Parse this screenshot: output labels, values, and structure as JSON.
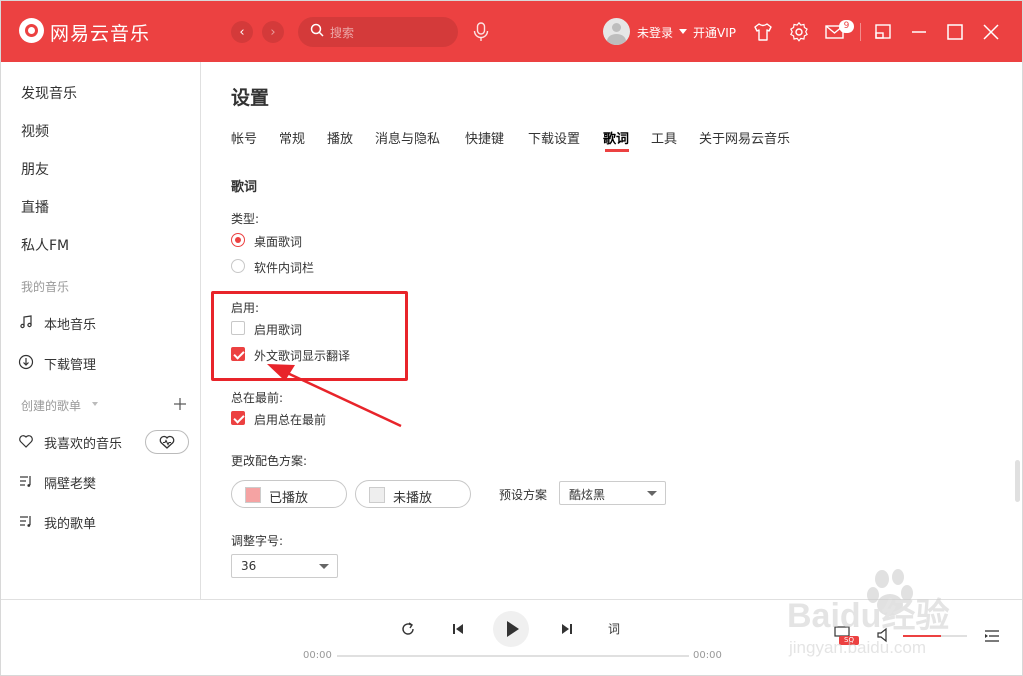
{
  "app": {
    "name": "网易云音乐"
  },
  "titlebar": {
    "search_placeholder": "搜索",
    "login_text": "未登录",
    "vip_text": "开通VIP",
    "mail_badge": "9"
  },
  "sidebar": {
    "main_items": [
      "发现音乐",
      "视频",
      "朋友",
      "直播",
      "私人FM"
    ],
    "my_music_title": "我的音乐",
    "my_music_items": [
      "本地音乐",
      "下载管理"
    ],
    "created_playlists_title": "创建的歌单",
    "playlists": [
      "我喜欢的音乐",
      "隔壁老樊",
      "我的歌单"
    ]
  },
  "settings": {
    "title": "设置",
    "tabs": [
      "帐号",
      "常规",
      "播放",
      "消息与隐私",
      "快捷键",
      "下载设置",
      "歌词",
      "工具",
      "关于网易云音乐"
    ],
    "active_tab": "歌词",
    "section_title": "歌词",
    "type_label": "类型:",
    "type_options": [
      {
        "label": "桌面歌词",
        "selected": true
      },
      {
        "label": "软件内词栏",
        "selected": false
      }
    ],
    "enable_label": "启用:",
    "enable_options": [
      {
        "label": "启用歌词",
        "checked": false
      },
      {
        "label": "外文歌词显示翻译",
        "checked": true
      }
    ],
    "always_top_label": "总在最前:",
    "always_top_option": {
      "label": "启用总在最前",
      "checked": true
    },
    "color_scheme_label": "更改配色方案:",
    "played_label": "已播放",
    "unplayed_label": "未播放",
    "preset_label": "预设方案",
    "preset_value": "酷炫黑",
    "font_size_label": "调整字号:",
    "font_size_value": "36"
  },
  "player": {
    "lyric_button": "词",
    "time_current": "00:00",
    "time_total": "00:00",
    "quality_badge": "SQ",
    "volume_level": 0.6
  },
  "watermark": {
    "text": "Baidu经验",
    "subtext": "jingyan.baidu.com"
  },
  "colors": {
    "accent": "#ec4141",
    "annotation": "#e8242a"
  }
}
